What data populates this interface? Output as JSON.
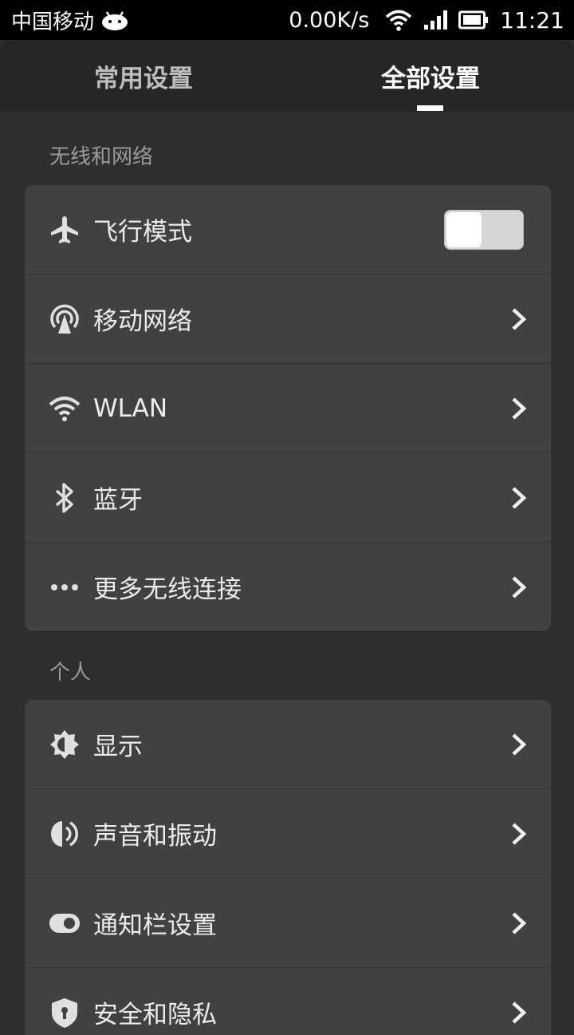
{
  "status_bar": {
    "carrier": "中国移动",
    "speed": "0.00K/s",
    "time": "11:21"
  },
  "tabs": [
    {
      "label": "常用设置",
      "active": false
    },
    {
      "label": "全部设置",
      "active": true
    }
  ],
  "sections": [
    {
      "title": "无线和网络",
      "items": [
        {
          "label": "飞行模式",
          "icon": "airplane-icon",
          "control": "toggle",
          "toggle_on": false
        },
        {
          "label": "移动网络",
          "icon": "mobile-network-icon",
          "control": "chevron"
        },
        {
          "label": "WLAN",
          "icon": "wifi-icon",
          "control": "chevron"
        },
        {
          "label": "蓝牙",
          "icon": "bluetooth-icon",
          "control": "chevron"
        },
        {
          "label": "更多无线连接",
          "icon": "more-dots-icon",
          "control": "chevron"
        }
      ]
    },
    {
      "title": "个人",
      "items": [
        {
          "label": "显示",
          "icon": "brightness-icon",
          "control": "chevron"
        },
        {
          "label": "声音和振动",
          "icon": "sound-icon",
          "control": "chevron"
        },
        {
          "label": "通知栏设置",
          "icon": "notification-toggle-icon",
          "control": "chevron"
        },
        {
          "label": "安全和隐私",
          "icon": "shield-icon",
          "control": "chevron"
        }
      ]
    }
  ],
  "colors": {
    "background": "#2e2e2e",
    "card": "#414141",
    "tabbar": "#262626",
    "accent": "#ffffff"
  }
}
